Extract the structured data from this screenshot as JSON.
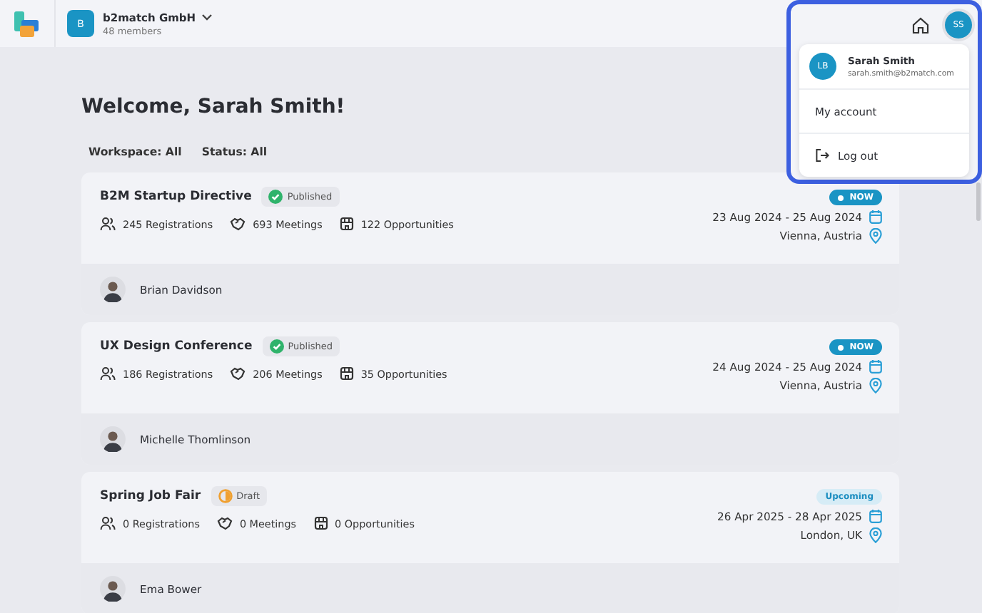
{
  "header": {
    "org_initial": "B",
    "org_name": "b2match GmbH",
    "org_members": "48 members",
    "user_initials": "SS"
  },
  "welcome": "Welcome, Sarah Smith!",
  "filters": [
    "Workspace: All",
    "Status: All"
  ],
  "events": [
    {
      "title": "B2M Startup Directive",
      "status": {
        "kind": "published",
        "label": "Published"
      },
      "stats": [
        "245 Registrations",
        "693 Meetings",
        "122 Opportunities"
      ],
      "badge": {
        "kind": "now",
        "label": "NOW"
      },
      "dates": "23 Aug 2024 - 25 Aug 2024",
      "location": "Vienna, Austria",
      "host": "Brian Davidson"
    },
    {
      "title": "UX Design Conference",
      "status": {
        "kind": "published",
        "label": "Published"
      },
      "stats": [
        "186 Registrations",
        "206 Meetings",
        "35 Opportunities"
      ],
      "badge": {
        "kind": "now",
        "label": "NOW"
      },
      "dates": "24 Aug 2024 - 25 Aug 2024",
      "location": "Vienna, Austria",
      "host": "Michelle Thomlinson"
    },
    {
      "title": "Spring Job Fair",
      "status": {
        "kind": "draft",
        "label": "Draft"
      },
      "stats": [
        "0 Registrations",
        "0 Meetings",
        "0 Opportunities"
      ],
      "badge": {
        "kind": "upcoming",
        "label": "Upcoming"
      },
      "dates": "26 Apr 2025 - 28 Apr 2025",
      "location": "London, UK",
      "host": "Ema Bower"
    }
  ],
  "user_menu": {
    "initials": "LB",
    "name": "Sarah Smith",
    "email": "sarah.smith@b2match.com",
    "items": [
      "My account",
      "Log out"
    ]
  }
}
